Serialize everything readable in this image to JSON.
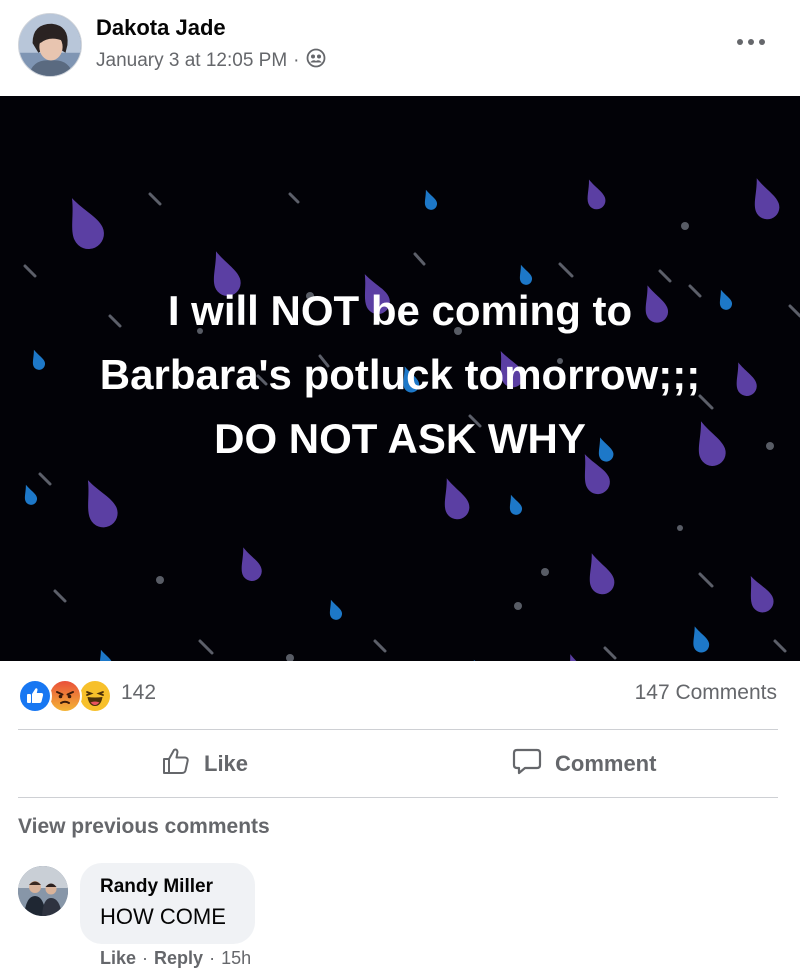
{
  "post": {
    "author": "Dakota Jade",
    "timestamp": "January 3 at 12:05 PM",
    "separator": "·",
    "audience_icon": "friends-icon",
    "more_icon": "more-options-icon",
    "image_text": [
      "I will NOT be coming to",
      "Barbara's potluck tomorrow;;;",
      "DO NOT ASK WHY"
    ]
  },
  "reactions": {
    "icons": [
      "like-reaction-icon",
      "angry-reaction-icon",
      "haha-reaction-icon"
    ],
    "count": "142",
    "comments_count": "147 Comments"
  },
  "actions": {
    "like_label": "Like",
    "comment_label": "Comment"
  },
  "comments": {
    "view_previous": "View previous comments",
    "items": [
      {
        "author": "Randy Miller",
        "text": "HOW COME",
        "like_label": "Like",
        "reply_label": "Reply",
        "time": "15h"
      }
    ]
  },
  "colors": {
    "secondary_text": "#65676b",
    "image_background": "#020207",
    "drop_purple": "#5b3fa3",
    "drop_blue": "#1d78c8",
    "divider": "#ced0d4",
    "comment_bubble": "#f0f2f5"
  }
}
